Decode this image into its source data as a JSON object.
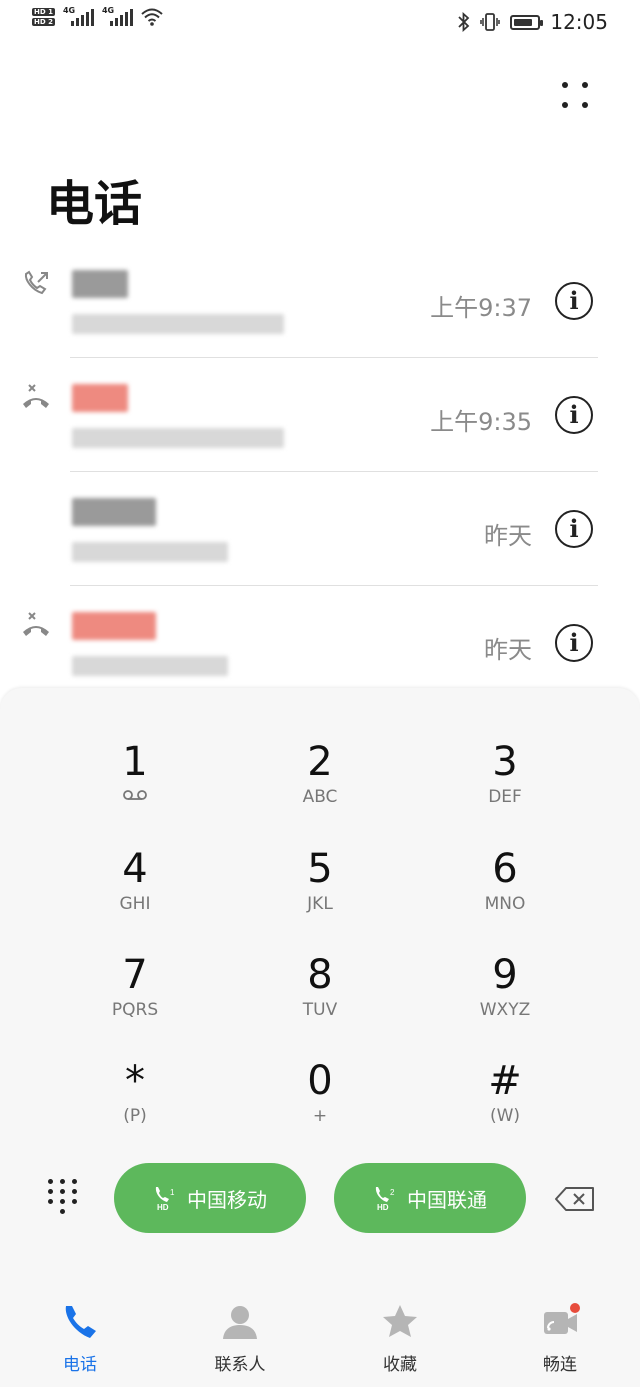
{
  "status_bar": {
    "network_label_1": "4G",
    "network_label_2": "4G",
    "sim1": "HD 1",
    "sim2": "HD 2",
    "time": "12:05"
  },
  "page": {
    "title": "电话"
  },
  "call_log": [
    {
      "call_type": "outgoing",
      "time": "上午9:37",
      "name_color": "#8a8a8a"
    },
    {
      "call_type": "missed",
      "time": "上午9:35",
      "name_color": "#ee8a80"
    },
    {
      "call_type": "incoming",
      "time": "昨天",
      "name_color": "#8a8a8a"
    },
    {
      "call_type": "missed",
      "time": "昨天",
      "name_color": "#ee8a80"
    }
  ],
  "dialpad": {
    "keys": [
      {
        "digit": "1",
        "letters": ""
      },
      {
        "digit": "2",
        "letters": "ABC"
      },
      {
        "digit": "3",
        "letters": "DEF"
      },
      {
        "digit": "4",
        "letters": "GHI"
      },
      {
        "digit": "5",
        "letters": "JKL"
      },
      {
        "digit": "6",
        "letters": "MNO"
      },
      {
        "digit": "7",
        "letters": "PQRS"
      },
      {
        "digit": "8",
        "letters": "TUV"
      },
      {
        "digit": "9",
        "letters": "WXYZ"
      },
      {
        "digit": "*",
        "letters": "(P)"
      },
      {
        "digit": "0",
        "letters": "+"
      },
      {
        "digit": "#",
        "letters": "(W)"
      }
    ],
    "voicemail_icon": "voicemail-icon"
  },
  "call_buttons": [
    {
      "label": "中国移动",
      "sim": "1",
      "sim_badge": "HD"
    },
    {
      "label": "中国联通",
      "sim": "2",
      "sim_badge": "HD"
    }
  ],
  "bottom_nav": [
    {
      "label": "电话",
      "icon": "phone-icon",
      "active": true
    },
    {
      "label": "联系人",
      "icon": "contacts-icon",
      "active": false
    },
    {
      "label": "收藏",
      "icon": "star-icon",
      "active": false
    },
    {
      "label": "畅连",
      "icon": "video-call-icon",
      "active": false
    }
  ],
  "colors": {
    "call_button": "#5db85c",
    "active_nav": "#1a73e8",
    "missed_badge": "#e74c3c"
  }
}
